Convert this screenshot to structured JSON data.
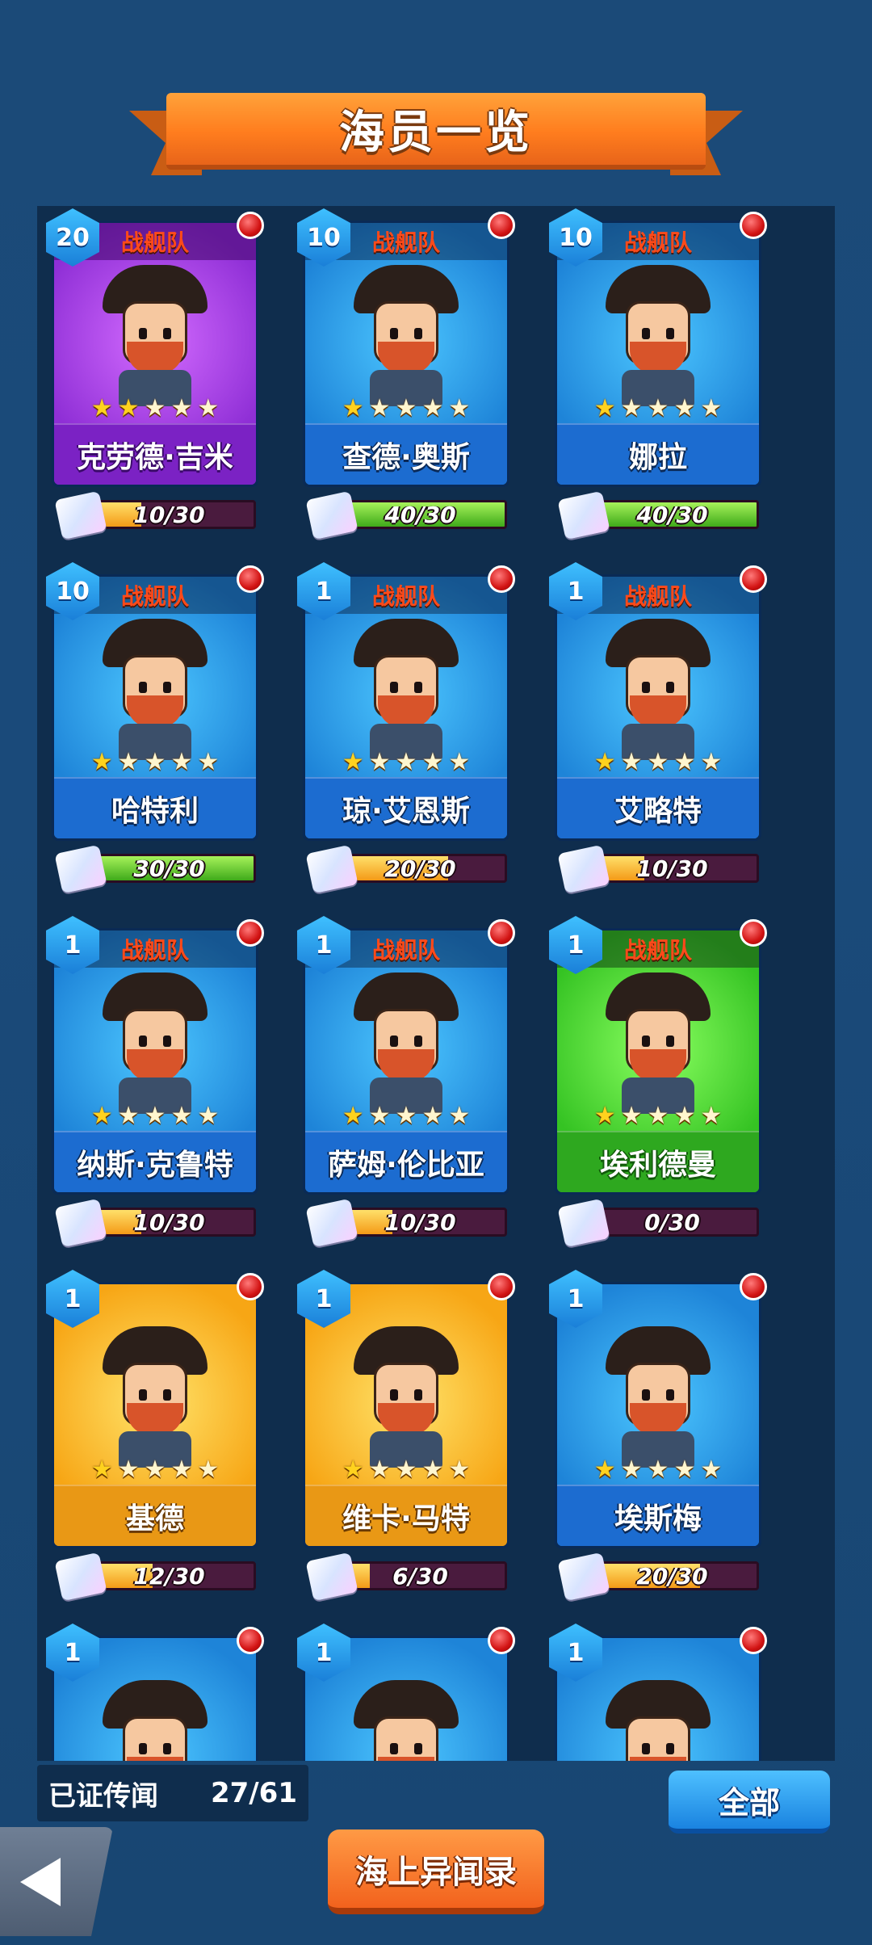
{
  "title": "海员一览",
  "team_label": "战舰队",
  "cards": [
    {
      "name": "克劳德·吉米",
      "level": "20",
      "stars": 2,
      "color": "purple",
      "team": true,
      "progress": "10/30",
      "progress_value": 0.333
    },
    {
      "name": "查德·奥斯",
      "level": "10",
      "stars": 1,
      "color": "blue",
      "team": true,
      "progress": "40/30",
      "progress_value": 1.0
    },
    {
      "name": "娜拉",
      "level": "10",
      "stars": 1,
      "color": "blue",
      "team": true,
      "progress": "40/30",
      "progress_value": 1.0
    },
    {
      "name": "哈特利",
      "level": "10",
      "stars": 1,
      "color": "blue",
      "team": true,
      "progress": "30/30",
      "progress_value": 1.0
    },
    {
      "name": "琼·艾恩斯",
      "level": "1",
      "stars": 1,
      "color": "blue",
      "team": true,
      "progress": "20/30",
      "progress_value": 0.667
    },
    {
      "name": "艾略特",
      "level": "1",
      "stars": 1,
      "color": "blue",
      "team": true,
      "progress": "10/30",
      "progress_value": 0.333
    },
    {
      "name": "纳斯·克鲁特",
      "level": "1",
      "stars": 1,
      "color": "blue",
      "team": true,
      "progress": "10/30",
      "progress_value": 0.333
    },
    {
      "name": "萨姆·伦比亚",
      "level": "1",
      "stars": 1,
      "color": "blue",
      "team": true,
      "progress": "10/30",
      "progress_value": 0.333
    },
    {
      "name": "埃利德曼",
      "level": "1",
      "stars": 1,
      "color": "green",
      "team": true,
      "progress": "0/30",
      "progress_value": 0.0
    },
    {
      "name": "基德",
      "level": "1",
      "stars": 1,
      "color": "gold",
      "team": false,
      "progress": "12/30",
      "progress_value": 0.4
    },
    {
      "name": "维卡·马特",
      "level": "1",
      "stars": 1,
      "color": "gold",
      "team": false,
      "progress": "6/30",
      "progress_value": 0.2
    },
    {
      "name": "埃斯梅",
      "level": "1",
      "stars": 1,
      "color": "blue",
      "team": false,
      "progress": "20/30",
      "progress_value": 0.667
    },
    {
      "name": "",
      "level": "1",
      "stars": 0,
      "color": "blue",
      "team": false,
      "progress": "",
      "progress_value": 0
    },
    {
      "name": "",
      "level": "1",
      "stars": 0,
      "color": "blue",
      "team": false,
      "progress": "",
      "progress_value": 0
    },
    {
      "name": "",
      "level": "1",
      "stars": 0,
      "color": "blue",
      "team": false,
      "progress": "",
      "progress_value": 0
    }
  ],
  "counter": {
    "label": "已证传闻",
    "value": "27/61"
  },
  "all_button": "全部",
  "log_button": "海上异闻录",
  "colors": {
    "accent_orange": "#ff7d1e",
    "panel": "#0f2d4d",
    "background": "#1a4a7a",
    "notify_red": "#d21313"
  }
}
